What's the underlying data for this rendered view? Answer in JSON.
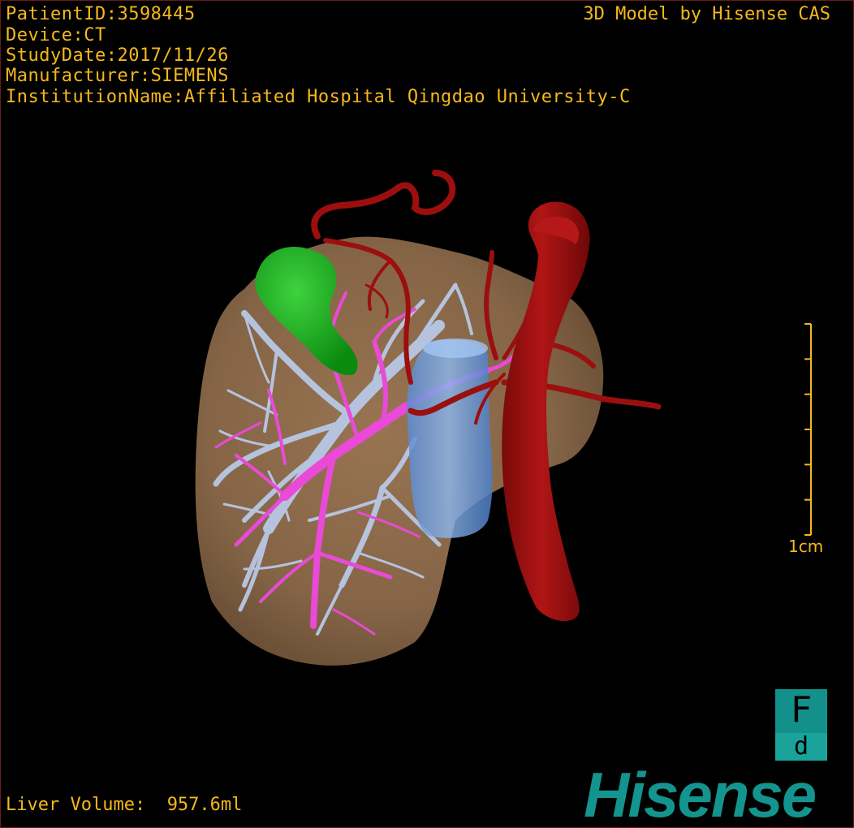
{
  "header": {
    "patient_id": "PatientID:3598445",
    "device": "Device:CT",
    "study_date": "StudyDate:2017/11/26",
    "manufacturer": "Manufacturer:SIEMENS",
    "institution": "InstitutionName:Affiliated Hospital Qingdao University-C"
  },
  "brand_text": "3D Model by Hisense CAS",
  "footer": {
    "volume_label": "Liver Volume:",
    "volume_value": "957.6ml"
  },
  "scale_bar": {
    "label": "1cm",
    "ticks": 7
  },
  "orientation_cube": {
    "top": "F",
    "bottom": "d"
  },
  "logo": {
    "text": "Hisense"
  },
  "colors": {
    "text": "#f5b81c",
    "liver": "#8c6a4a",
    "hepatic_vein": "#b8c8e6",
    "portal_vein": "#e94ad6",
    "artery": "#9b0f0f",
    "gallbladder": "#15a81a",
    "ivc": "#6a9ee0",
    "brand": "#14948e"
  },
  "model_icons": [
    "liver-shape",
    "hepatic-veins",
    "portal-veins",
    "aorta",
    "gallbladder",
    "vena-cava"
  ]
}
